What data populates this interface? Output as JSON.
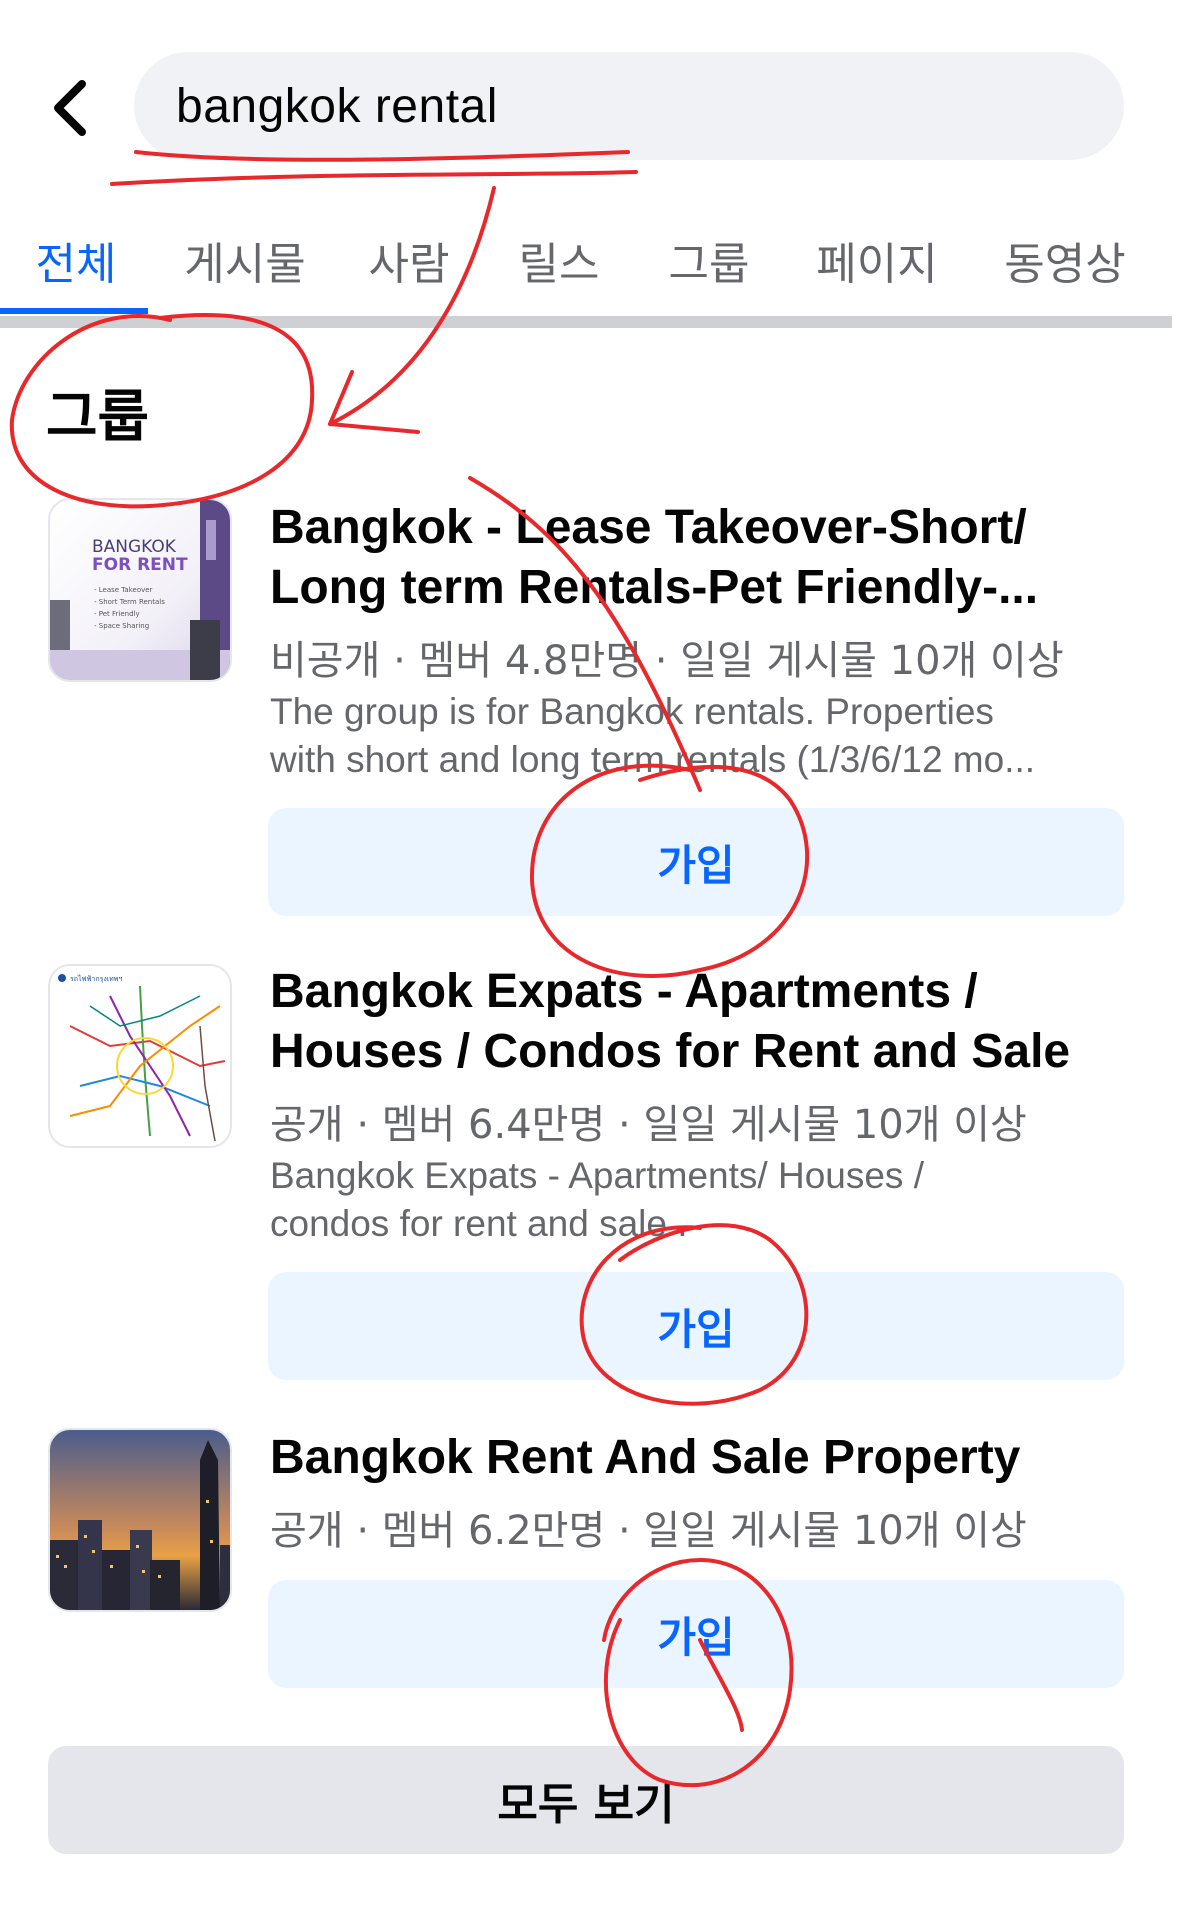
{
  "search": {
    "query": "bangkok rental",
    "back_icon": "chevron-left-icon"
  },
  "tabs": [
    {
      "label": "전체",
      "active": true
    },
    {
      "label": "게시물",
      "active": false
    },
    {
      "label": "사람",
      "active": false
    },
    {
      "label": "릴스",
      "active": false
    },
    {
      "label": "그룹",
      "active": false
    },
    {
      "label": "페이지",
      "active": false
    },
    {
      "label": "동영상",
      "active": false
    }
  ],
  "section": {
    "title": "그룹"
  },
  "groups": [
    {
      "title_line1": "Bangkok - Lease Takeover-Short/",
      "title_line2": "Long term Rentals-Pet Friendly-...",
      "meta": "비공개 · 멤버 4.8만명 · 일일 게시물 10개 이상",
      "desc_line1": "The group is for Bangkok rentals. Properties",
      "desc_line2": "with short and long term rentals (1/3/6/12 mo...",
      "join_label": "가입",
      "thumb": {
        "line1": "BANGKOK",
        "line2": "FOR RENT",
        "bullets": [
          "- Lease Takeover",
          "- Short Term Rentals",
          "- Pet Friendly",
          "- Space Sharing"
        ]
      }
    },
    {
      "title_line1": "Bangkok Expats - Apartments /",
      "title_line2": "Houses / Condos for Rent and Sale",
      "meta": "공개 · 멤버 6.4만명 · 일일 게시물 10개 이상",
      "desc_line1": "Bangkok Expats - Apartments/ Houses /",
      "desc_line2": "condos for rent and sale .",
      "join_label": "가입",
      "thumb": {
        "caption": "รถไฟฟ้ากรุงเทพฯ"
      }
    },
    {
      "title_line1": "Bangkok Rent And Sale Property",
      "meta": "공개 · 멤버 6.2만명 · 일일 게시물 10개 이상",
      "join_label": "가입",
      "thumb": {}
    }
  ],
  "see_all_label": "모두 보기",
  "colors": {
    "accent": "#0866ff",
    "join_bg": "#ebf5ff",
    "annotation": "#e8282b"
  }
}
